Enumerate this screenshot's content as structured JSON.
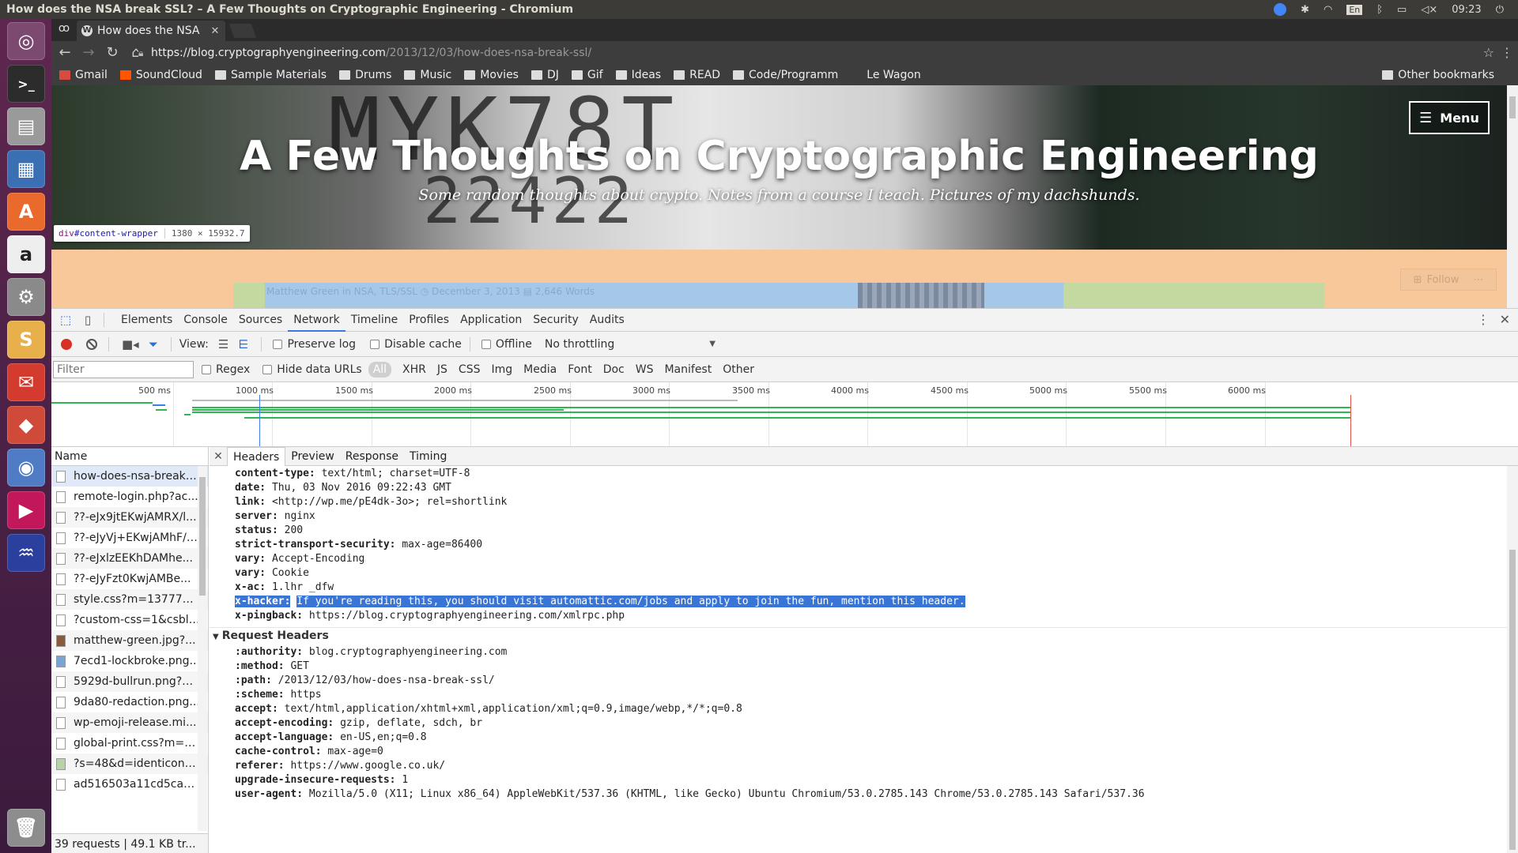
{
  "os": {
    "window_title": "How does the NSA break SSL? – A Few Thoughts on Cryptographic Engineering - Chromium",
    "clock": "09:23",
    "tray_icons": [
      "chrome-icon",
      "settings-icon",
      "wifi-icon",
      "keyboard-layout-icon",
      "bluetooth-icon",
      "battery-icon",
      "volume-icon"
    ],
    "keyboard_layout": "En"
  },
  "launcher": {
    "items": [
      "ubuntu-logo-icon",
      "terminal-icon",
      "files-icon",
      "libreoffice-writer-icon",
      "software-center-icon",
      "amazon-icon",
      "system-settings-icon",
      "slack-icon",
      "mail-icon",
      "git-icon",
      "chromium-icon",
      "music-player-icon",
      "audio-editor-icon",
      "trash-icon"
    ]
  },
  "browser": {
    "tab_title": "How does the NSA",
    "url_host": "https://blog.cryptographyengineering.com",
    "url_path": "/2013/12/03/how-does-nsa-break-ssl/",
    "bookmarks": [
      "Gmail",
      "SoundCloud",
      "Sample Materials",
      "Drums",
      "Music",
      "Movies",
      "DJ",
      "Gif",
      "Ideas",
      "READ",
      "Code/Programm",
      "Le Wagon"
    ],
    "other_bookmarks": "Other bookmarks"
  },
  "page": {
    "site_title": "A Few Thoughts on Cryptographic Engineering",
    "tagline": "Some random thoughts about crypto. Notes from a course I teach. Pictures of my dachshunds.",
    "menu_label": "Menu",
    "inspect_tag": "div",
    "inspect_id": "#content-wrapper",
    "inspect_size": "1380 × 15932.7",
    "post_meta": "Matthew Green in NSA, TLS/SSL    ◷ December 3, 2013    ▤ 2,646 Words",
    "follow_label": "Follow"
  },
  "devtools": {
    "panels": [
      "Elements",
      "Console",
      "Sources",
      "Network",
      "Timeline",
      "Profiles",
      "Application",
      "Security",
      "Audits"
    ],
    "selected_panel": "Network",
    "toolbar": {
      "view_label": "View:",
      "preserve_log": "Preserve log",
      "disable_cache": "Disable cache",
      "offline": "Offline",
      "throttling": "No throttling"
    },
    "filter": {
      "placeholder": "Filter",
      "regex": "Regex",
      "hide_data_urls": "Hide data URLs",
      "types": [
        "All",
        "XHR",
        "JS",
        "CSS",
        "Img",
        "Media",
        "Font",
        "Doc",
        "WS",
        "Manifest",
        "Other"
      ]
    },
    "overview_ticks": [
      "500 ms",
      "1000 ms",
      "1500 ms",
      "2000 ms",
      "2500 ms",
      "3000 ms",
      "3500 ms",
      "4000 ms",
      "4500 ms",
      "5000 ms",
      "5500 ms",
      "6000 ms"
    ],
    "name_header": "Name",
    "requests": [
      "how-does-nsa-break-...",
      "remote-login.php?ac...",
      "??-eJx9jtEKwjAMRX/l...",
      "??-eJyVj+EKwjAMhF/l...",
      "??-eJxlzEEKhDAMhe...",
      "??-eJyFzt0KwjAMBe...",
      "style.css?m=1377793...",
      "?custom-css=1&csblo...",
      "matthew-green.jpg?...",
      "7ecd1-lockbroke.png...",
      "5929d-bullrun.png?w...",
      "9da80-redaction.png...",
      "wp-emoji-release.mi...",
      "global-print.css?m=1...",
      "?s=48&d=identicon&...",
      "ad516503a11cd5ca4..."
    ],
    "status": "39 requests  |  49.1 KB tr...",
    "detail_tabs": [
      "Headers",
      "Preview",
      "Response",
      "Timing"
    ],
    "response_headers": [
      {
        "k": "content-type:",
        "v": "text/html; charset=UTF-8"
      },
      {
        "k": "date:",
        "v": "Thu, 03 Nov 2016 09:22:43 GMT"
      },
      {
        "k": "link:",
        "v": "<http://wp.me/pE4dk-3o>; rel=shortlink"
      },
      {
        "k": "server:",
        "v": "nginx"
      },
      {
        "k": "status:",
        "v": "200"
      },
      {
        "k": "strict-transport-security:",
        "v": "max-age=86400"
      },
      {
        "k": "vary:",
        "v": "Accept-Encoding"
      },
      {
        "k": "vary:",
        "v": "Cookie"
      },
      {
        "k": "x-ac:",
        "v": "1.lhr _dfw"
      },
      {
        "k": "x-hacker:",
        "v": "If you're reading this, you should visit automattic.com/jobs and apply to join the fun, mention this header."
      },
      {
        "k": "x-pingback:",
        "v": "https://blog.cryptographyengineering.com/xmlrpc.php"
      }
    ],
    "request_headers_title": "Request Headers",
    "request_headers": [
      {
        "k": ":authority:",
        "v": "blog.cryptographyengineering.com"
      },
      {
        "k": ":method:",
        "v": "GET"
      },
      {
        "k": ":path:",
        "v": "/2013/12/03/how-does-nsa-break-ssl/"
      },
      {
        "k": ":scheme:",
        "v": "https"
      },
      {
        "k": "accept:",
        "v": "text/html,application/xhtml+xml,application/xml;q=0.9,image/webp,*/*;q=0.8"
      },
      {
        "k": "accept-encoding:",
        "v": "gzip, deflate, sdch, br"
      },
      {
        "k": "accept-language:",
        "v": "en-US,en;q=0.8"
      },
      {
        "k": "cache-control:",
        "v": "max-age=0"
      },
      {
        "k": "referer:",
        "v": "https://www.google.co.uk/"
      },
      {
        "k": "upgrade-insecure-requests:",
        "v": "1"
      },
      {
        "k": "user-agent:",
        "v": "Mozilla/5.0 (X11; Linux x86_64) AppleWebKit/537.36 (KHTML, like Gecko) Ubuntu Chromium/53.0.2785.143 Chrome/53.0.2785.143 Safari/537.36"
      }
    ]
  }
}
